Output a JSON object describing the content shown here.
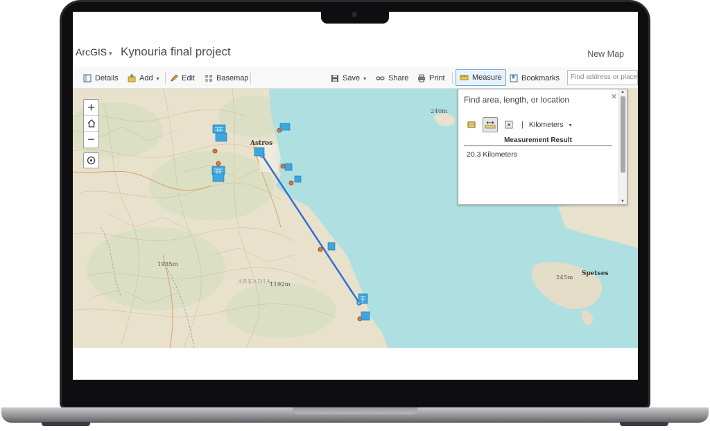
{
  "app": {
    "brand": "ArcGIS",
    "title": "Kynouria final project",
    "new_map": "New Map"
  },
  "toolbar": {
    "details": "Details",
    "add": "Add",
    "edit": "Edit",
    "basemap": "Basemap",
    "save": "Save",
    "share": "Share",
    "print": "Print",
    "measure": "Measure",
    "bookmarks": "Bookmarks",
    "search_placeholder": "Find address or place"
  },
  "map": {
    "labels": {
      "astros": "Astros",
      "spetses": "Spetses",
      "elev_240": "240m",
      "elev_1935": "1935m",
      "elev_1192": "1192m",
      "elev_245": "245m",
      "arkadia": "ARKADIA"
    },
    "measure_line_color": "#2f6fd6",
    "marker_color": "#e8762c",
    "icon_color": "#3aa7e0",
    "sea_color": "#aee0e1",
    "land_color": "#e9e2cf"
  },
  "measure_panel": {
    "title": "Find area, length, or location",
    "units": "Kilometers",
    "result_header": "Measurement Result",
    "result": "20.3 Kilometers",
    "active_tool": "distance"
  }
}
